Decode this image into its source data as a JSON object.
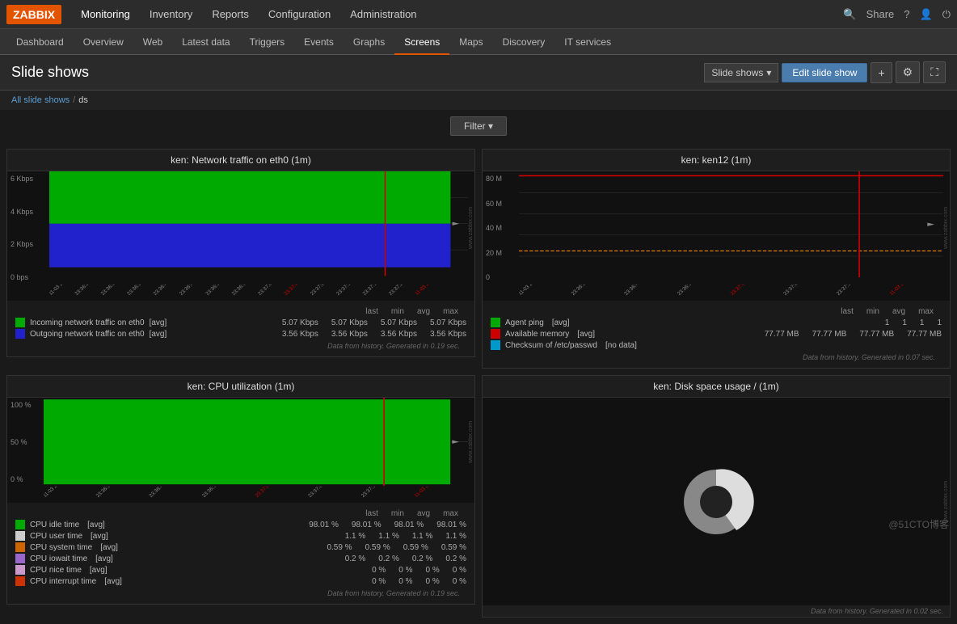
{
  "app": {
    "logo": "ZABBIX",
    "title": "Slide shows"
  },
  "topnav": {
    "items": [
      {
        "label": "Monitoring",
        "active": true
      },
      {
        "label": "Inventory",
        "active": false
      },
      {
        "label": "Reports",
        "active": false
      },
      {
        "label": "Configuration",
        "active": false
      },
      {
        "label": "Administration",
        "active": false
      }
    ],
    "right": {
      "share": "Share",
      "help": "?",
      "user": "👤",
      "power": "⏻"
    }
  },
  "subnav": {
    "items": [
      {
        "label": "Dashboard"
      },
      {
        "label": "Overview"
      },
      {
        "label": "Web"
      },
      {
        "label": "Latest data"
      },
      {
        "label": "Triggers"
      },
      {
        "label": "Events"
      },
      {
        "label": "Graphs"
      },
      {
        "label": "Screens"
      },
      {
        "label": "Maps"
      },
      {
        "label": "Discovery"
      },
      {
        "label": "IT services"
      }
    ],
    "active": "Screens"
  },
  "header": {
    "title": "Slide shows",
    "breadcrumb": {
      "parent_link": "All slide shows",
      "separator": "/",
      "current": "ds"
    },
    "actions": {
      "slide_shows_btn": "Slide shows",
      "edit_slide_show_btn": "Edit slide show",
      "add_btn": "+",
      "settings_btn": "⚙",
      "fullscreen_btn": "⛶"
    }
  },
  "filter": {
    "label": "Filter ▾"
  },
  "charts": {
    "net_traffic": {
      "title": "ken: Network traffic on eth0 (1m)",
      "y_labels": [
        "6 Kbps",
        "4 Kbps",
        "2 Kbps",
        "0 bps"
      ],
      "legend": {
        "headers": [
          "last",
          "min",
          "avg",
          "max"
        ],
        "rows": [
          {
            "color": "#00cc00",
            "label": "Incoming network traffic on eth0",
            "avg_label": "[avg]",
            "last": "5.07 Kbps",
            "min": "5.07 Kbps",
            "avg": "5.07 Kbps",
            "max": "5.07 Kbps"
          },
          {
            "color": "#0000cc",
            "label": "Outgoing network traffic on eth0",
            "avg_label": "[avg]",
            "last": "3.56 Kbps",
            "min": "3.56 Kbps",
            "avg": "3.56 Kbps",
            "max": "3.56 Kbps"
          }
        ]
      },
      "data_note": "Data from history. Generated in 0.19 sec."
    },
    "ken12": {
      "title": "ken: ken12 (1m)",
      "y_labels": [
        "80 M",
        "60 M",
        "40 M",
        "20 M",
        "0"
      ],
      "legend": {
        "headers": [
          "last",
          "min",
          "avg",
          "max"
        ],
        "rows": [
          {
            "color": "#00cc00",
            "label": "Agent ping",
            "avg_label": "[avg]",
            "last": "1",
            "min": "1",
            "avg": "1",
            "max": "1"
          },
          {
            "color": "#cc0000",
            "label": "Available memory",
            "avg_label": "[avg]",
            "last": "77.77 MB",
            "min": "77.77 MB",
            "avg": "77.77 MB",
            "max": "77.77 MB"
          },
          {
            "color": "#0099cc",
            "label": "Checksum of /etc/passwd",
            "avg_label": "[no data]",
            "last": "",
            "min": "",
            "avg": "",
            "max": ""
          }
        ]
      },
      "data_note": "Data from history. Generated in 0.07 sec."
    },
    "cpu": {
      "title": "ken: CPU utilization (1m)",
      "y_labels": [
        "100 %",
        "50 %",
        "0 %"
      ],
      "legend": {
        "headers": [
          "last",
          "min",
          "avg",
          "max"
        ],
        "rows": [
          {
            "color": "#00cc00",
            "label": "CPU idle time",
            "avg_label": "[avg]",
            "last": "98.01 %",
            "min": "98.01 %",
            "avg": "98.01 %",
            "max": "98.01 %"
          },
          {
            "color": "#cccccc",
            "label": "CPU user time",
            "avg_label": "[avg]",
            "last": "1.1 %",
            "min": "1.1 %",
            "avg": "1.1 %",
            "max": "1.1 %"
          },
          {
            "color": "#cc6600",
            "label": "CPU system time",
            "avg_label": "[avg]",
            "last": "0.59 %",
            "min": "0.59 %",
            "avg": "0.59 %",
            "max": "0.59 %"
          },
          {
            "color": "#9966cc",
            "label": "CPU iowait time",
            "avg_label": "[avg]",
            "last": "0.2 %",
            "min": "0.2 %",
            "avg": "0.2 %",
            "max": "0.2 %"
          },
          {
            "color": "#cc99cc",
            "label": "CPU nice time",
            "avg_label": "[avg]",
            "last": "0 %",
            "min": "0 %",
            "avg": "0 %",
            "max": "0 %"
          },
          {
            "color": "#cc3300",
            "label": "CPU interrupt time",
            "avg_label": "[avg]",
            "last": "0 %",
            "min": "0 %",
            "avg": "0 %",
            "max": "0 %"
          }
        ]
      },
      "data_note": "Data from history. Generated in 0.19 sec."
    },
    "disk": {
      "title": "ken: Disk space usage / (1m)",
      "data_note": "Data from history. Generated in 0.02 sec."
    }
  },
  "watermark": "@51CTO博客"
}
